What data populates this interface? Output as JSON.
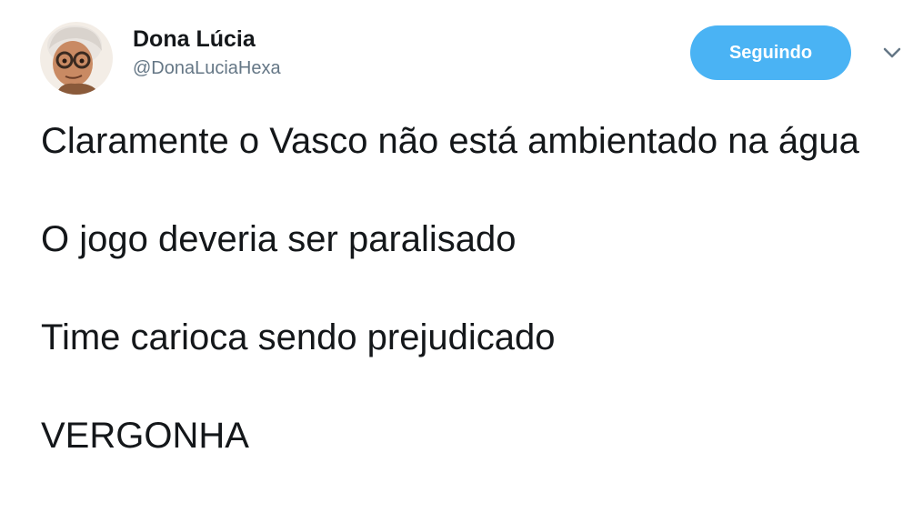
{
  "author": {
    "display_name": "Dona Lúcia",
    "handle": "@DonaLuciaHexa",
    "avatar_icon": "elderly-woman-avatar"
  },
  "follow_button": {
    "label": "Seguindo",
    "color": "#4ab3f4"
  },
  "menu": {
    "icon": "chevron-down-icon"
  },
  "tweet": {
    "paragraphs": [
      "Claramente o Vasco não está ambientado na água",
      "O jogo deveria ser paralisado",
      "Time carioca sendo prejudicado",
      "VERGONHA"
    ]
  }
}
